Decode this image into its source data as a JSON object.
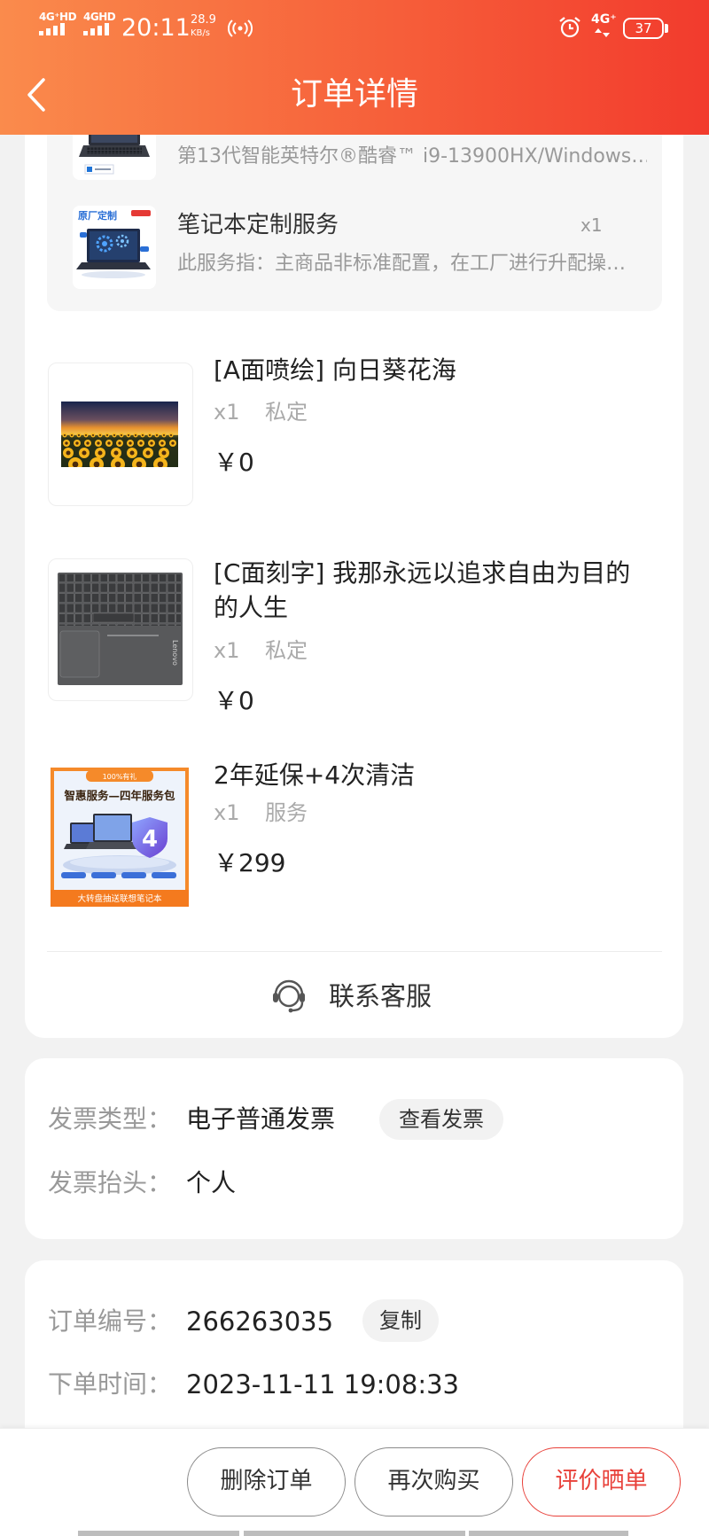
{
  "status_bar": {
    "signal_1_label": "4G⁺HD",
    "signal_2_label": "4GHD",
    "time": "20:11",
    "net_speed_value": "28.9",
    "net_speed_unit": "KB/s",
    "hotspot_icon": "hotspot-icon",
    "alarm_icon": "alarm-icon",
    "network_type": "4G⁺",
    "battery_level": "37"
  },
  "header": {
    "title": "订单详情",
    "back_icon": "chevron-left-icon"
  },
  "bundle": {
    "items": [
      {
        "desc": "第13代智能英特尔®酷睿™ i9-13900HX/Windows…"
      },
      {
        "name": "笔记本定制服务",
        "qty": "x1",
        "desc": "此服务指：主商品非标准配置，在工厂进行升配操…",
        "image_label": "原厂定制"
      }
    ]
  },
  "items": [
    {
      "title": "[A面喷绘] 向日葵花海",
      "qty": "x1",
      "tag": "私定",
      "price": "￥0"
    },
    {
      "title": "[C面刻字] 我那永远以追求自由为目的的人生",
      "qty": "x1",
      "tag": "私定",
      "price": "￥0",
      "image_logo_text": "Lenovo"
    },
    {
      "title": "2年延保+4次清洁",
      "qty": "x1",
      "tag": "服务",
      "price": "￥299",
      "image_tag": "100%有礼",
      "image_title": "智惠服务—四年服务包",
      "image_badge": "4",
      "image_footer": "大转盘抽送联想笔记本"
    }
  ],
  "contact": {
    "label": "联系客服",
    "icon": "headset-icon"
  },
  "invoice": {
    "type_label": "发票类型：",
    "type_value": "电子普通发票",
    "view_button": "查看发票",
    "title_label": "发票抬头：",
    "title_value": "个人"
  },
  "order": {
    "number_label": "订单编号：",
    "number_value": "266263035",
    "copy_button": "复制",
    "time_label": "下单时间：",
    "time_value": "2023-11-11 19:08:33"
  },
  "actions": {
    "delete": "删除订单",
    "rebuy": "再次购买",
    "review": "评价晒单"
  },
  "colors": {
    "header_gradient_start": "#fa8b4c",
    "header_gradient_end": "#f23b2d",
    "accent_red": "#e8413a",
    "text_primary": "#222222",
    "text_secondary": "#999999",
    "page_bg": "#f2f2f2"
  }
}
